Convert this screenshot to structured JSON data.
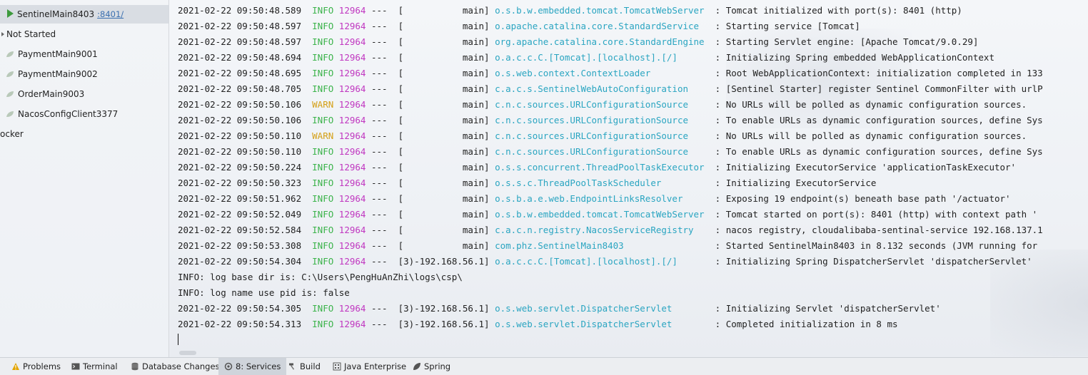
{
  "sidebar": {
    "items": [
      {
        "label": "SentinelMain8403",
        "port": ":8401/",
        "type": "running",
        "selected": true
      },
      {
        "label": "Not Started",
        "type": "group"
      },
      {
        "label": "PaymentMain9001",
        "type": "app"
      },
      {
        "label": "PaymentMain9002",
        "type": "app"
      },
      {
        "label": "OrderMain9003",
        "type": "app"
      },
      {
        "label": "NacosConfigClient3377",
        "type": "app"
      },
      {
        "label": "ocker",
        "type": "group-cut"
      }
    ]
  },
  "console": {
    "lines": [
      {
        "ts": "2021-02-22 09:50:48.589",
        "level": "INFO",
        "pid": "12964",
        "thread": "---  [           main]",
        "logger": "o.s.b.w.embedded.tomcat.TomcatWebServer ",
        "msg": ": Tomcat initialized with port(s): 8401 (http)"
      },
      {
        "ts": "2021-02-22 09:50:48.597",
        "level": "INFO",
        "pid": "12964",
        "thread": "---  [           main]",
        "logger": "o.apache.catalina.core.StandardService  ",
        "msg": ": Starting service [Tomcat]"
      },
      {
        "ts": "2021-02-22 09:50:48.597",
        "level": "INFO",
        "pid": "12964",
        "thread": "---  [           main]",
        "logger": "org.apache.catalina.core.StandardEngine ",
        "msg": ": Starting Servlet engine: [Apache Tomcat/9.0.29]"
      },
      {
        "ts": "2021-02-22 09:50:48.694",
        "level": "INFO",
        "pid": "12964",
        "thread": "---  [           main]",
        "logger": "o.a.c.c.C.[Tomcat].[localhost].[/]      ",
        "msg": ": Initializing Spring embedded WebApplicationContext"
      },
      {
        "ts": "2021-02-22 09:50:48.695",
        "level": "INFO",
        "pid": "12964",
        "thread": "---  [           main]",
        "logger": "o.s.web.context.ContextLoader           ",
        "msg": ": Root WebApplicationContext: initialization completed in 133"
      },
      {
        "ts": "2021-02-22 09:50:48.705",
        "level": "INFO",
        "pid": "12964",
        "thread": "---  [           main]",
        "logger": "c.a.c.s.SentinelWebAutoConfiguration    ",
        "msg": ": [Sentinel Starter] register Sentinel CommonFilter with urlP"
      },
      {
        "ts": "2021-02-22 09:50:50.106",
        "level": "WARN",
        "pid": "12964",
        "thread": "---  [           main]",
        "logger": "c.n.c.sources.URLConfigurationSource    ",
        "msg": ": No URLs will be polled as dynamic configuration sources."
      },
      {
        "ts": "2021-02-22 09:50:50.106",
        "level": "INFO",
        "pid": "12964",
        "thread": "---  [           main]",
        "logger": "c.n.c.sources.URLConfigurationSource    ",
        "msg": ": To enable URLs as dynamic configuration sources, define Sys"
      },
      {
        "ts": "2021-02-22 09:50:50.110",
        "level": "WARN",
        "pid": "12964",
        "thread": "---  [           main]",
        "logger": "c.n.c.sources.URLConfigurationSource    ",
        "msg": ": No URLs will be polled as dynamic configuration sources."
      },
      {
        "ts": "2021-02-22 09:50:50.110",
        "level": "INFO",
        "pid": "12964",
        "thread": "---  [           main]",
        "logger": "c.n.c.sources.URLConfigurationSource    ",
        "msg": ": To enable URLs as dynamic configuration sources, define Sys"
      },
      {
        "ts": "2021-02-22 09:50:50.224",
        "level": "INFO",
        "pid": "12964",
        "thread": "---  [           main]",
        "logger": "o.s.s.concurrent.ThreadPoolTaskExecutor ",
        "msg": ": Initializing ExecutorService 'applicationTaskExecutor'"
      },
      {
        "ts": "2021-02-22 09:50:50.323",
        "level": "INFO",
        "pid": "12964",
        "thread": "---  [           main]",
        "logger": "o.s.s.c.ThreadPoolTaskScheduler         ",
        "msg": ": Initializing ExecutorService"
      },
      {
        "ts": "2021-02-22 09:50:51.962",
        "level": "INFO",
        "pid": "12964",
        "thread": "---  [           main]",
        "logger": "o.s.b.a.e.web.EndpointLinksResolver     ",
        "msg": ": Exposing 19 endpoint(s) beneath base path '/actuator'"
      },
      {
        "ts": "2021-02-22 09:50:52.049",
        "level": "INFO",
        "pid": "12964",
        "thread": "---  [           main]",
        "logger": "o.s.b.w.embedded.tomcat.TomcatWebServer ",
        "msg": ": Tomcat started on port(s): 8401 (http) with context path '"
      },
      {
        "ts": "2021-02-22 09:50:52.584",
        "level": "INFO",
        "pid": "12964",
        "thread": "---  [           main]",
        "logger": "c.a.c.n.registry.NacosServiceRegistry   ",
        "msg": ": nacos registry, cloudalibaba-sentinal-service 192.168.137.1"
      },
      {
        "ts": "2021-02-22 09:50:53.308",
        "level": "INFO",
        "pid": "12964",
        "thread": "---  [           main]",
        "logger": "com.phz.SentinelMain8403                ",
        "msg": ": Started SentinelMain8403 in 8.132 seconds (JVM running for"
      },
      {
        "ts": "2021-02-22 09:50:54.304",
        "level": "INFO",
        "pid": "12964",
        "thread": "---  [3)-192.168.56.1]",
        "logger": "o.a.c.c.C.[Tomcat].[localhost].[/]      ",
        "msg": ": Initializing Spring DispatcherServlet 'dispatcherServlet'"
      },
      {
        "plain": "INFO: log base dir is: C:\\Users\\PengHuAnZhi\\logs\\csp\\"
      },
      {
        "plain": "INFO: log name use pid is: false"
      },
      {
        "ts": "2021-02-22 09:50:54.305",
        "level": "INFO",
        "pid": "12964",
        "thread": "---  [3)-192.168.56.1]",
        "logger": "o.s.web.servlet.DispatcherServlet       ",
        "msg": ": Initializing Servlet 'dispatcherServlet'"
      },
      {
        "ts": "2021-02-22 09:50:54.313",
        "level": "INFO",
        "pid": "12964",
        "thread": "---  [3)-192.168.56.1]",
        "logger": "o.s.web.servlet.DispatcherServlet       ",
        "msg": ": Completed initialization in 8 ms"
      }
    ]
  },
  "toolbar": {
    "tabs": [
      {
        "label": "Problems",
        "icon": "warning-icon"
      },
      {
        "label": "Terminal",
        "icon": "terminal-icon"
      },
      {
        "label": "Database Changes",
        "icon": "database-icon"
      },
      {
        "label": "8: Services",
        "icon": "services-icon",
        "active": true
      },
      {
        "label": "Build",
        "icon": "hammer-icon"
      },
      {
        "label": "Java Enterprise",
        "icon": "java-enterprise-icon"
      },
      {
        "label": "Spring",
        "icon": "spring-leaf-icon"
      }
    ]
  },
  "colors": {
    "info": "#3bb34a",
    "warn": "#d4a017",
    "pid": "#c036c0",
    "logger": "#2aa5c1"
  }
}
